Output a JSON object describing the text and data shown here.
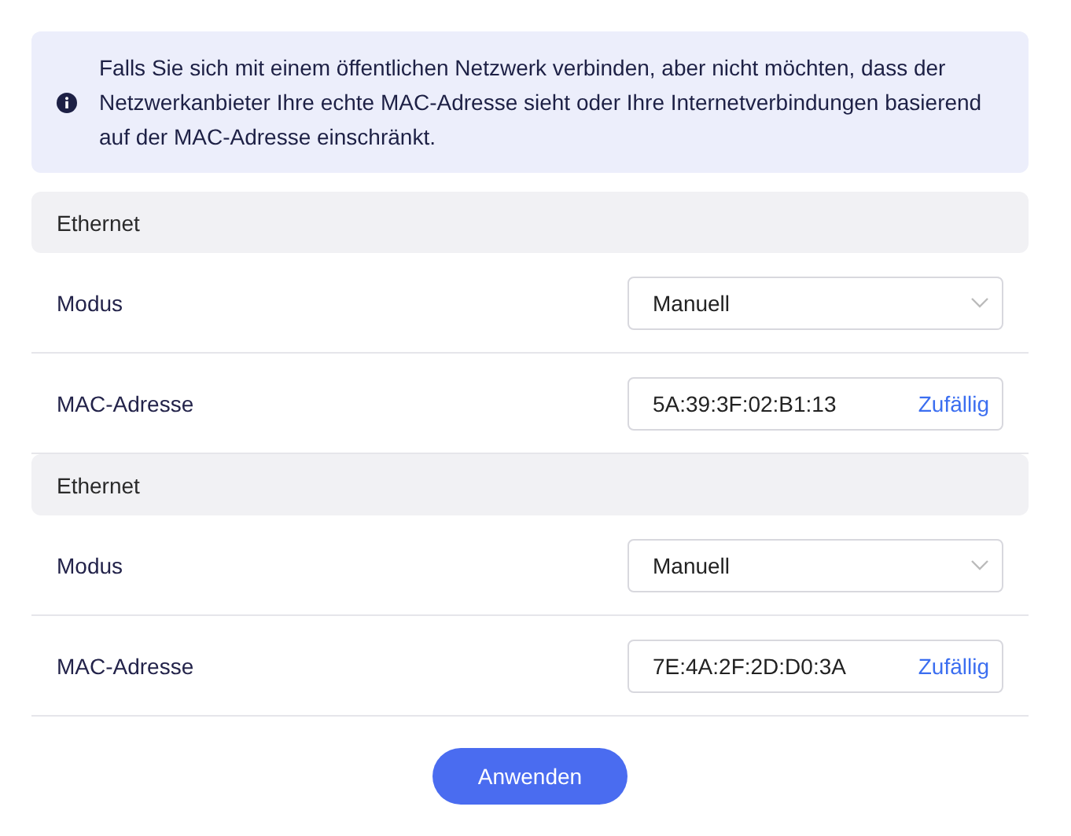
{
  "notice": {
    "text": "Falls Sie sich mit einem öffentlichen Netzwerk verbinden, aber nicht möchten, dass der Netzwerkanbieter Ihre echte MAC-Adresse sieht oder Ihre Internetverbindungen basierend auf der MAC-Adresse einschränkt."
  },
  "sections": [
    {
      "title": "Ethernet",
      "rows": [
        {
          "kind": "select",
          "label": "Modus",
          "value": "Manuell"
        },
        {
          "kind": "mac",
          "label": "MAC-Adresse",
          "value": "5A:39:3F:02:B1:13",
          "action": "Zufällig"
        }
      ]
    },
    {
      "title": "Ethernet",
      "rows": [
        {
          "kind": "select",
          "label": "Modus",
          "value": "Manuell"
        },
        {
          "kind": "mac",
          "label": "MAC-Adresse",
          "value": "7E:4A:2F:2D:D0:3A",
          "action": "Zufällig"
        }
      ]
    }
  ],
  "apply_button": {
    "label": "Anwenden"
  }
}
